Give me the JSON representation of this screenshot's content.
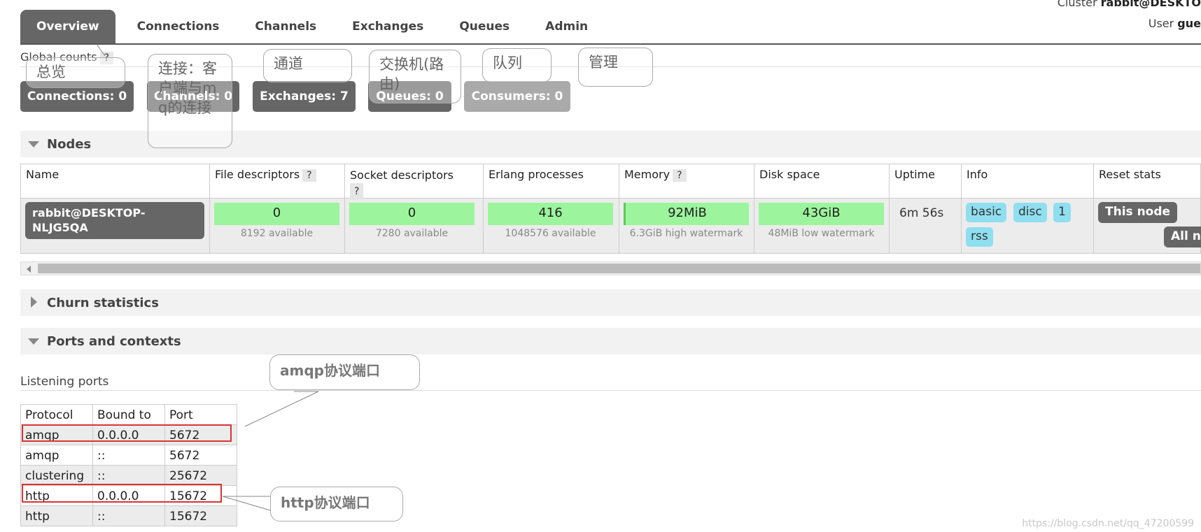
{
  "header": {
    "cluster_label": "Cluster",
    "cluster_value": "rabbit@DESKTO",
    "user_label": "User",
    "user_value": "gue"
  },
  "tabs": [
    "Overview",
    "Connections",
    "Channels",
    "Exchanges",
    "Queues",
    "Admin"
  ],
  "global_counts": {
    "label": "Global counts",
    "help": "?",
    "items": [
      {
        "label": "Connections: 0"
      },
      {
        "label": "Channels: 0"
      },
      {
        "label": "Exchanges: 7"
      },
      {
        "label": "Queues: 0"
      },
      {
        "label": "Consumers: 0"
      }
    ]
  },
  "annotations": {
    "overview": "总览",
    "connections": "连接：客户端与mq的连接",
    "channels": "通道",
    "exchanges": "交换机(路由)",
    "queues": "队列",
    "admin": "管理",
    "amqp": "amqp协议端口",
    "http": "http协议端口"
  },
  "nodes": {
    "title": "Nodes",
    "columns": {
      "name": "Name",
      "file": "File descriptors",
      "socket": "Socket descriptors",
      "erlang": "Erlang processes",
      "memory": "Memory",
      "disk": "Disk space",
      "uptime": "Uptime",
      "info": "Info",
      "reset": "Reset stats",
      "help": "?"
    },
    "row": {
      "name": "rabbit@DESKTOP-NLJG5QA",
      "file_value": "0",
      "file_sub": "8192 available",
      "socket_value": "0",
      "socket_sub": "7280 available",
      "erlang_value": "416",
      "erlang_sub": "1048576 available",
      "memory_value": "92MiB",
      "memory_sub": "6.3GiB high watermark",
      "disk_value": "43GiB",
      "disk_sub": "48MiB low watermark",
      "uptime": "6m 56s",
      "tags": [
        "basic",
        "disc",
        "1",
        "rss"
      ],
      "reset_this": "This node",
      "reset_all": "All no"
    }
  },
  "churn": {
    "title": "Churn statistics"
  },
  "ports": {
    "title": "Ports and contexts",
    "listening_label": "Listening ports",
    "headers": [
      "Protocol",
      "Bound to",
      "Port"
    ],
    "rows": [
      [
        "amqp",
        "0.0.0.0",
        "5672"
      ],
      [
        "amqp",
        "::",
        "5672"
      ],
      [
        "clustering",
        "::",
        "25672"
      ],
      [
        "http",
        "0.0.0.0",
        "15672"
      ],
      [
        "http",
        "::",
        "15672"
      ]
    ]
  },
  "watermark": "https://blog.csdn.net/qq_47200599"
}
